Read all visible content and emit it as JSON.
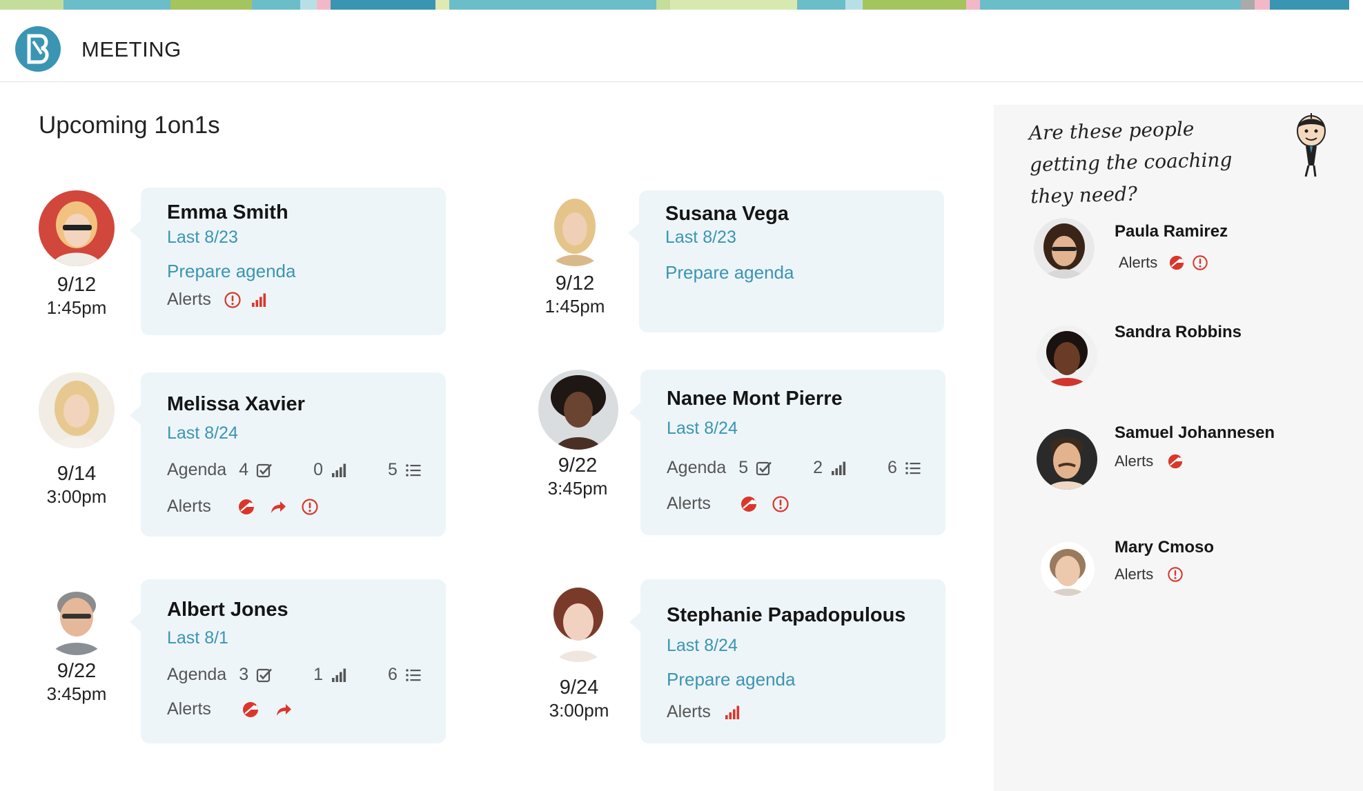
{
  "app": {
    "title": "MEETING"
  },
  "colors": {
    "accent": "#3a95b3",
    "alert": "#d9372b",
    "card_bg": "#eef5f8"
  },
  "page": {
    "title": "Upcoming 1on1s"
  },
  "meetings": [
    {
      "name": "Emma Smith",
      "last": "Last 8/23",
      "date": "9/12",
      "time": "1:45pm",
      "prepare": "Prepare agenda",
      "alerts_label": "Alerts",
      "alerts": [
        "warning-icon",
        "bar-chart-icon"
      ]
    },
    {
      "name": "Susana Vega",
      "last": "Last 8/23",
      "date": "9/12",
      "time": "1:45pm",
      "prepare": "Prepare agenda"
    },
    {
      "name": "Melissa Xavier",
      "last": "Last 8/24",
      "date": "9/14",
      "time": "3:00pm",
      "agenda_label": "Agenda",
      "agenda": {
        "tasks": "4",
        "stats": "0",
        "items": "5"
      },
      "alerts_label": "Alerts",
      "alerts": [
        "pie-alert-icon",
        "forward-arrow-icon",
        "warning-icon"
      ]
    },
    {
      "name": "Nanee Mont Pierre",
      "last": "Last 8/24",
      "date": "9/22",
      "time": "3:45pm",
      "agenda_label": "Agenda",
      "agenda": {
        "tasks": "5",
        "stats": "2",
        "items": "6"
      },
      "alerts_label": "Alerts",
      "alerts": [
        "pie-alert-icon",
        "warning-icon"
      ]
    },
    {
      "name": "Albert Jones",
      "last": "Last 8/1",
      "date": "9/22",
      "time": "3:45pm",
      "agenda_label": "Agenda",
      "agenda": {
        "tasks": "3",
        "stats": "1",
        "items": "6"
      },
      "alerts_label": "Alerts",
      "alerts": [
        "pie-alert-icon",
        "forward-arrow-icon"
      ]
    },
    {
      "name": "Stephanie Papadopulous",
      "last": "Last 8/24",
      "date": "9/24",
      "time": "3:00pm",
      "prepare": "Prepare agenda",
      "alerts_label": "Alerts",
      "alerts": [
        "bar-chart-icon"
      ]
    }
  ],
  "sidebar": {
    "question": "Are these people getting the coaching they need?",
    "people": [
      {
        "name": "Paula Ramirez",
        "alerts_label": "Alerts",
        "alerts": [
          "pie-alert-icon",
          "warning-icon"
        ]
      },
      {
        "name": "Sandra Robbins"
      },
      {
        "name": "Samuel Johannesen",
        "alerts_label": "Alerts",
        "alerts": [
          "pie-alert-icon"
        ]
      },
      {
        "name": "Mary Cmoso",
        "alerts_label": "Alerts",
        "alerts": [
          "warning-icon"
        ]
      }
    ]
  }
}
